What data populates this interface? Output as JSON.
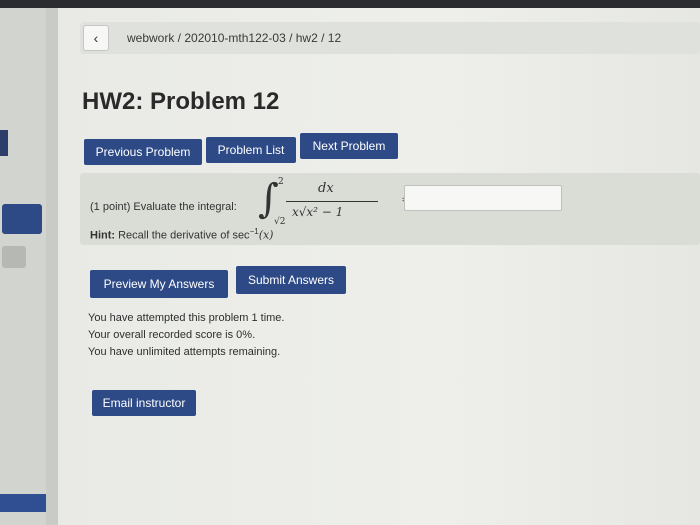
{
  "header": {
    "back_icon": "chevron-left-icon",
    "breadcrumb": "webwork / 202010-mth122-03 / hw2 / 12"
  },
  "page_title": "HW2: Problem 12",
  "nav": {
    "previous": "Previous Problem",
    "list": "Problem List",
    "next": "Next Problem"
  },
  "problem": {
    "points_text": "(1 point) Evaluate the integral:",
    "integral": {
      "upper": "2",
      "lower": "√2",
      "numerator": "dx",
      "denominator": "x√x² − 1"
    },
    "equals": "=",
    "answer_value": "",
    "hint_label": "Hint:",
    "hint_text": "Recall the derivative of sec",
    "hint_sup": "−1",
    "hint_arg": "(x)"
  },
  "actions": {
    "preview": "Preview My Answers",
    "submit": "Submit Answers"
  },
  "status": {
    "attempted": "You have attempted this problem 1 time.",
    "score": "Your overall recorded score is 0%.",
    "remaining": "You have unlimited attempts remaining."
  },
  "email": "Email instructor",
  "colors": {
    "button": "#2d4a86",
    "background": "#eeefeb"
  }
}
